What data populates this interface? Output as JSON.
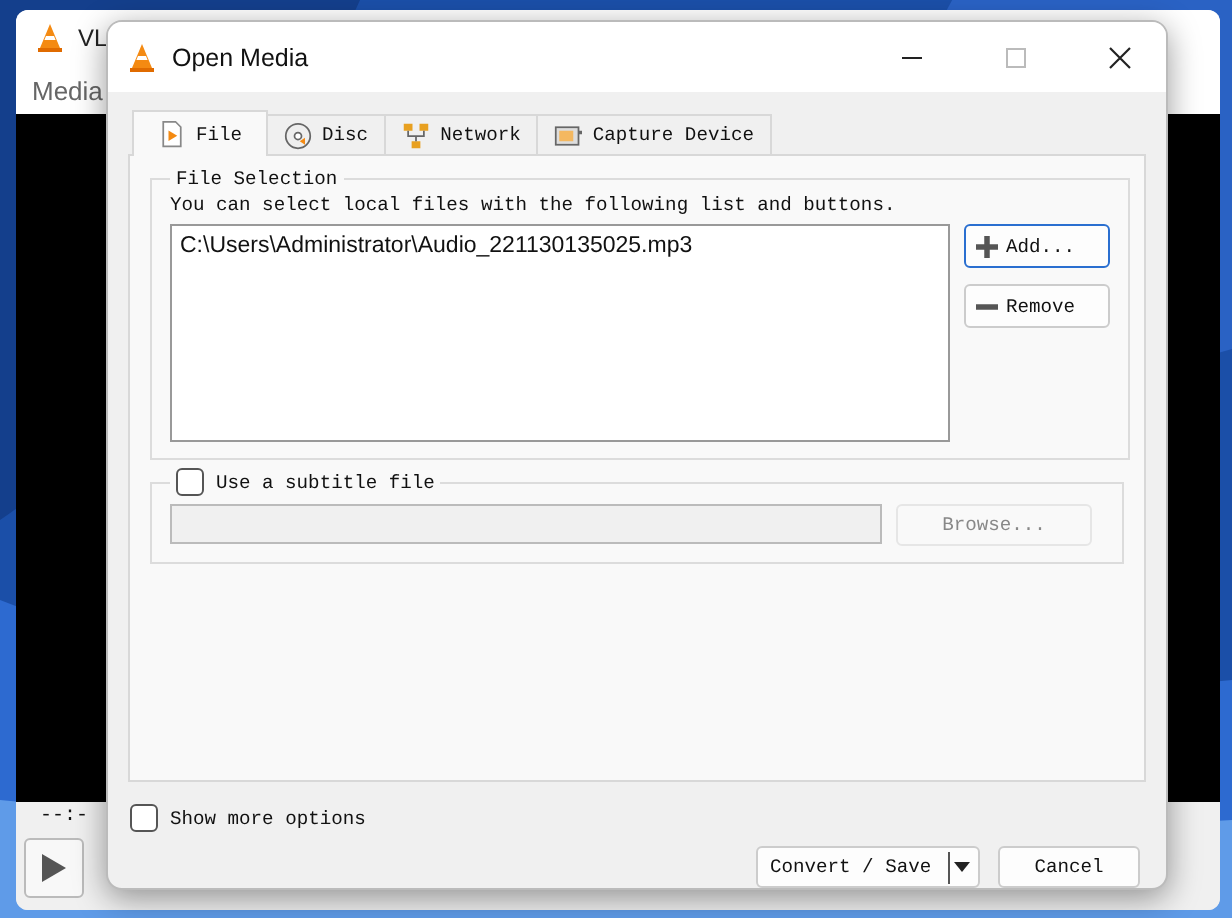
{
  "background_window": {
    "title": "VL",
    "menu": [
      "Media"
    ],
    "time": "--:-"
  },
  "window": {
    "title": "Open Media"
  },
  "tabs": [
    {
      "label": "File",
      "kind": "file",
      "selected": true
    },
    {
      "label": "Disc",
      "kind": "disc",
      "selected": false
    },
    {
      "label": "Network",
      "kind": "network",
      "selected": false
    },
    {
      "label": "Capture Device",
      "kind": "capture",
      "selected": false
    }
  ],
  "file_selection": {
    "title": "File Selection",
    "hint": "You can select local files with the following list and buttons.",
    "files": [
      "C:\\Users\\Administrator\\Audio_221130135025.mp3"
    ],
    "buttons": [
      {
        "label": "Add...",
        "kind": "add"
      },
      {
        "label": "Remove",
        "kind": "remove"
      }
    ]
  },
  "subtitle": {
    "label": "Use a subtitle file",
    "checked": false,
    "browse": "Browse...",
    "disabled": true
  },
  "show_more": {
    "label": "Show more options",
    "checked": false
  },
  "buttons": [
    {
      "label": "Convert / Save",
      "kind": "split"
    },
    {
      "label": "Cancel",
      "kind": "plain"
    }
  ]
}
